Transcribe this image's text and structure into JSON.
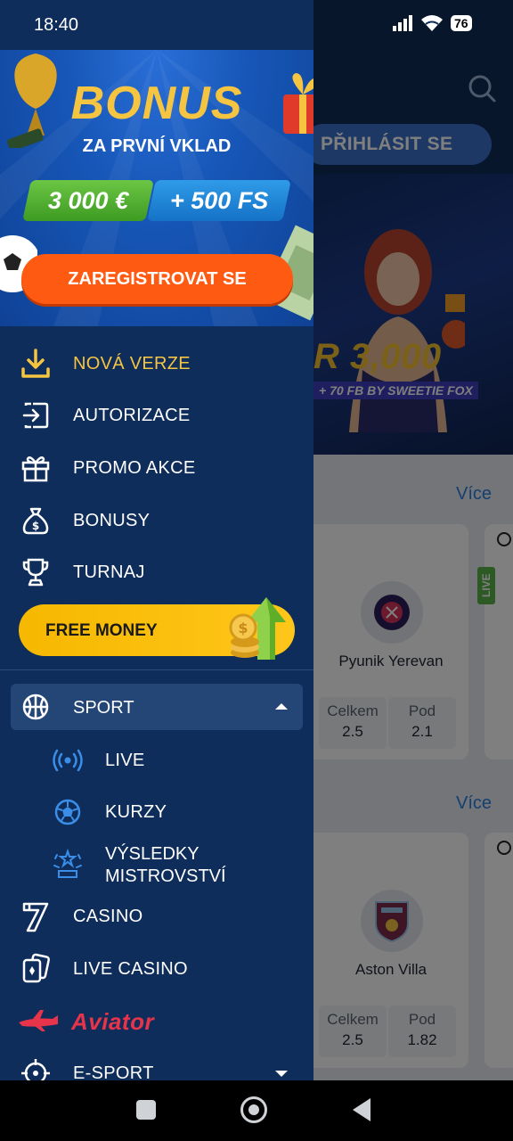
{
  "status_bar": {
    "time": "18:40",
    "battery": "76"
  },
  "promo": {
    "title": "BONUS",
    "subtitle": "ZA PRVNÍ VKLAD",
    "bonus_money": "3 000 €",
    "bonus_spins": "+ 500 FS",
    "register_button": "ZAREGISTROVAT SE"
  },
  "menu": {
    "new_version": "NOVÁ VERZE",
    "authorization": "AUTORIZACE",
    "promo_actions": "PROMO AKCE",
    "bonuses": "BONUSY",
    "tournament": "TURNAJ",
    "free_money": "FREE MONEY",
    "sport": "SPORT",
    "live": "LIVE",
    "odds": "KURZY",
    "championship_results": "VÝSLEDKY MISTROVSTVÍ",
    "casino": "CASINO",
    "live_casino": "LIVE CASINO",
    "aviator": "Aviator",
    "esport": "E-SPORT"
  },
  "background": {
    "login_button": "PŘIHLÁSIT SE",
    "banner_amount": "R 3,000",
    "banner_sub": "+ 70 FB BY SWEETIE FOX",
    "more_1": "Více",
    "more_2": "Více",
    "live_tag": "LIVE",
    "team_1": "Pyunik Yerevan",
    "team_2": "Aston Villa",
    "odds_total_label_1": "Celkem",
    "odds_total_value_1": "2.5",
    "odds_under_label_1": "Pod",
    "odds_under_value_1": "2.1",
    "odds_total_label_2": "Celkem",
    "odds_total_value_2": "2.5",
    "odds_under_label_2": "Pod",
    "odds_under_value_2": "1.82"
  },
  "colors": {
    "drawer_bg": "#0f2d5a",
    "accent_yellow": "#f5c542",
    "register_orange": "#ff5a12",
    "free_money_yellow": "#ffc61a"
  }
}
